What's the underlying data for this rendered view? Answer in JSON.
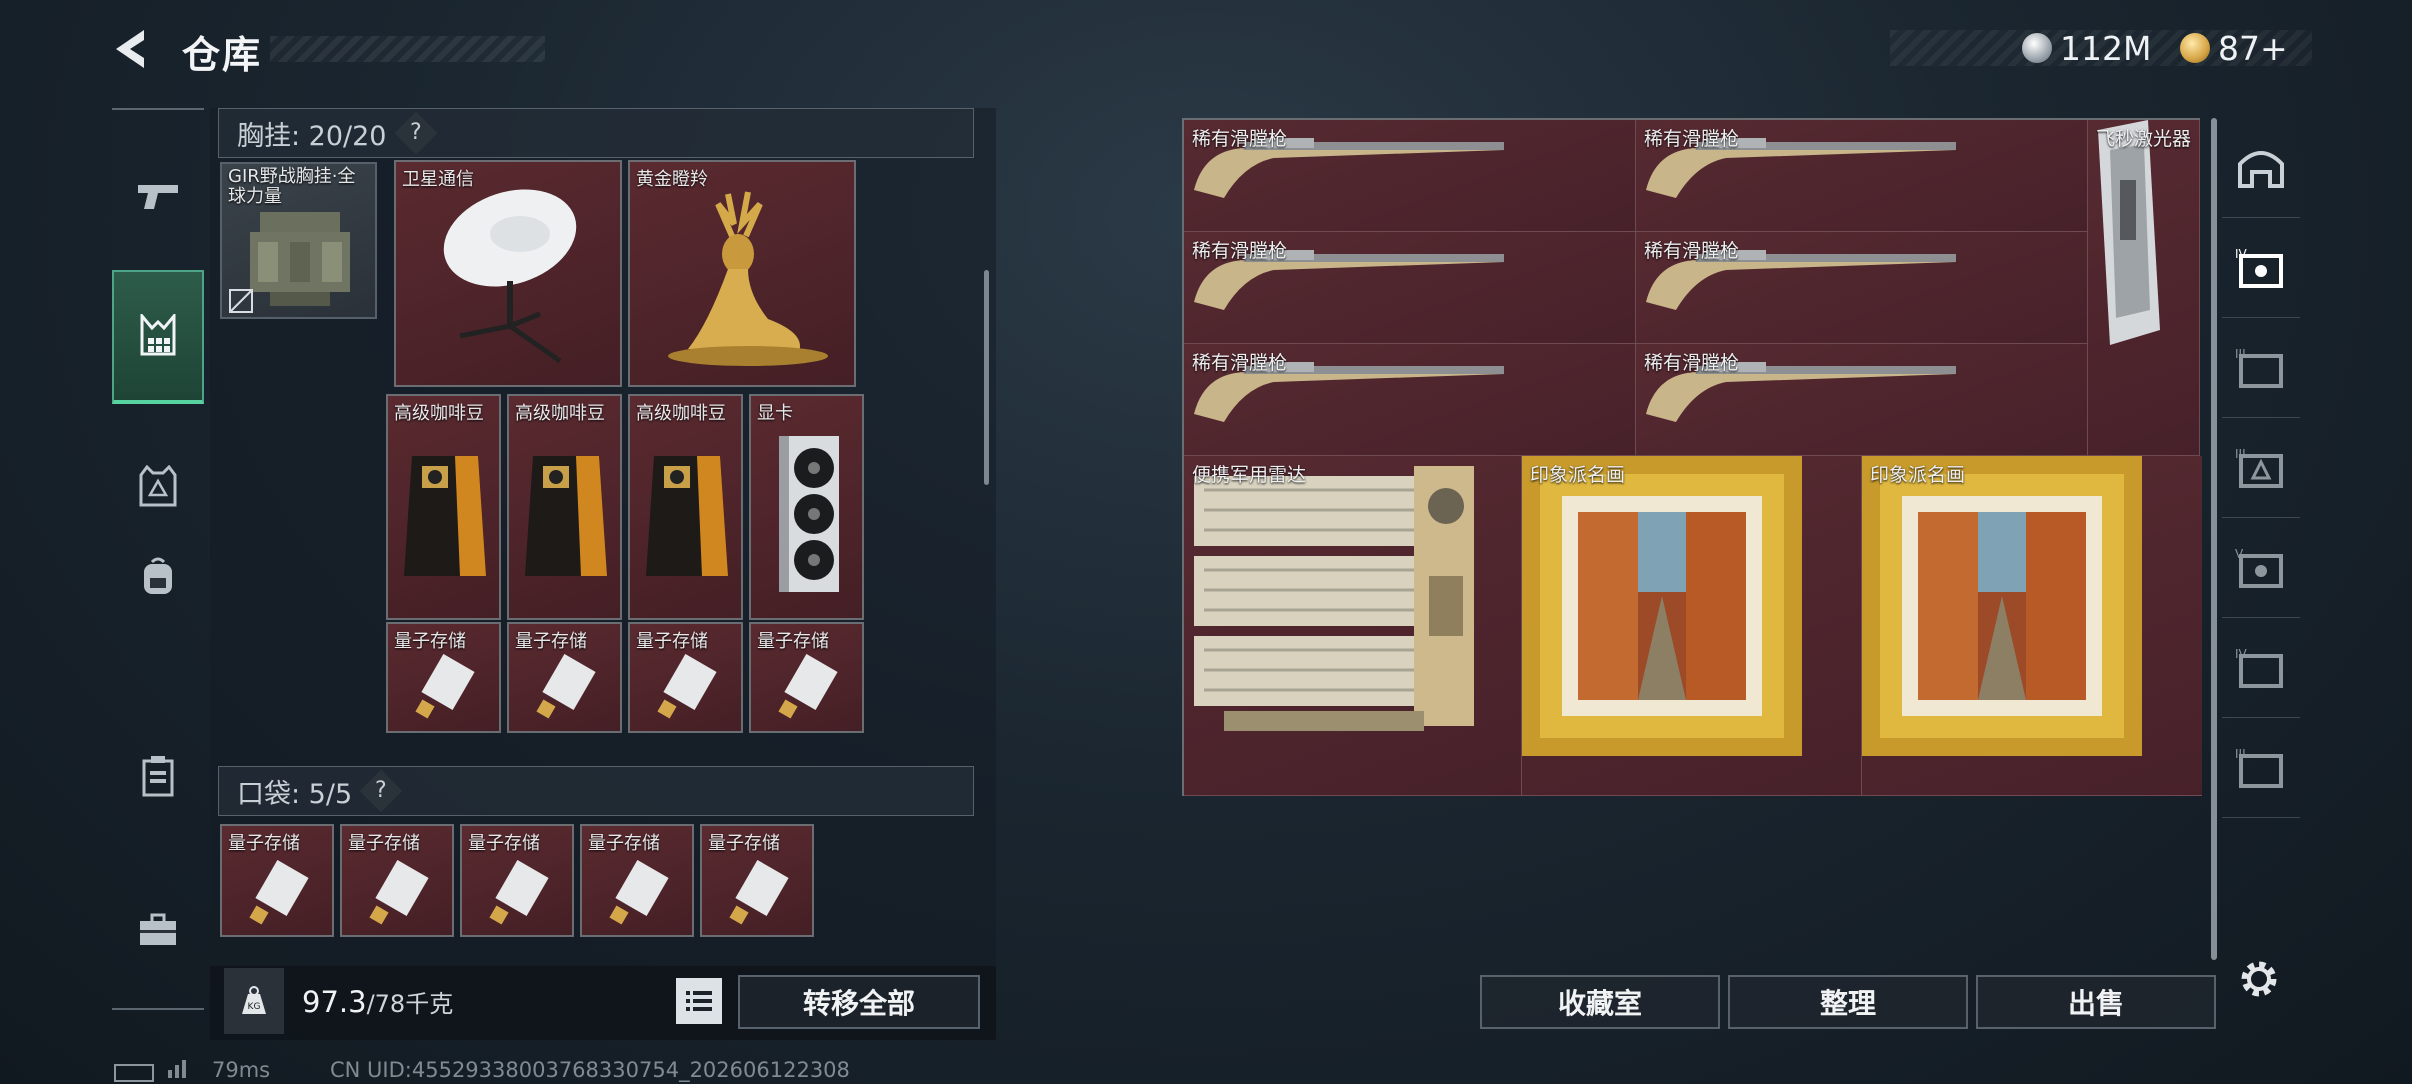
{
  "header": {
    "title": "仓库",
    "currency_silver": "112M",
    "currency_gold": "87+"
  },
  "chest": {
    "header": "胸挂: 20/20",
    "help": "?",
    "rig_label": "GIR野战胸挂·全球力量",
    "items": [
      {
        "label": "卫星通信",
        "icon": "satellite-dish-icon"
      },
      {
        "label": "黄金瞪羚",
        "icon": "golden-deer-icon"
      },
      {
        "label": "高级咖啡豆",
        "icon": "coffee-bag-icon"
      },
      {
        "label": "高级咖啡豆",
        "icon": "coffee-bag-icon"
      },
      {
        "label": "高级咖啡豆",
        "icon": "coffee-bag-icon"
      },
      {
        "label": "显卡",
        "icon": "graphics-card-icon"
      },
      {
        "label": "量子存储",
        "icon": "quantum-storage-icon"
      },
      {
        "label": "量子存储",
        "icon": "quantum-storage-icon"
      },
      {
        "label": "量子存储",
        "icon": "quantum-storage-icon"
      },
      {
        "label": "量子存储",
        "icon": "quantum-storage-icon"
      }
    ]
  },
  "pocket": {
    "header": "口袋: 5/5",
    "help": "?",
    "items": [
      "量子存储",
      "量子存储",
      "量子存储",
      "量子存储",
      "量子存储"
    ]
  },
  "weight": {
    "value": "97.3",
    "limit": "/78千克"
  },
  "actions": {
    "transfer_all": "转移全部",
    "collection": "收藏室",
    "organize": "整理",
    "sell": "出售"
  },
  "stash": {
    "items": [
      {
        "label": "稀有滑膛枪",
        "icon": "musket-icon"
      },
      {
        "label": "稀有滑膛枪",
        "icon": "musket-icon"
      },
      {
        "label": "飞秒激光器",
        "icon": "laser-device-icon"
      },
      {
        "label": "稀有滑膛枪",
        "icon": "musket-icon"
      },
      {
        "label": "稀有滑膛枪",
        "icon": "musket-icon"
      },
      {
        "label": "稀有滑膛枪",
        "icon": "musket-icon"
      },
      {
        "label": "稀有滑膛枪",
        "icon": "musket-icon"
      },
      {
        "label": "便携军用雷达",
        "icon": "radar-icon"
      },
      {
        "label": "印象派名画",
        "icon": "painting-icon"
      },
      {
        "label": "印象派名画",
        "icon": "painting-icon"
      }
    ]
  },
  "status": {
    "ping": "79ms",
    "uid": "CN UID:4552933800376833075​4_202606122308"
  },
  "colors": {
    "slot_red": "#4a2329",
    "accent_green": "#56d3a0",
    "panel_dark": "#141c24"
  }
}
